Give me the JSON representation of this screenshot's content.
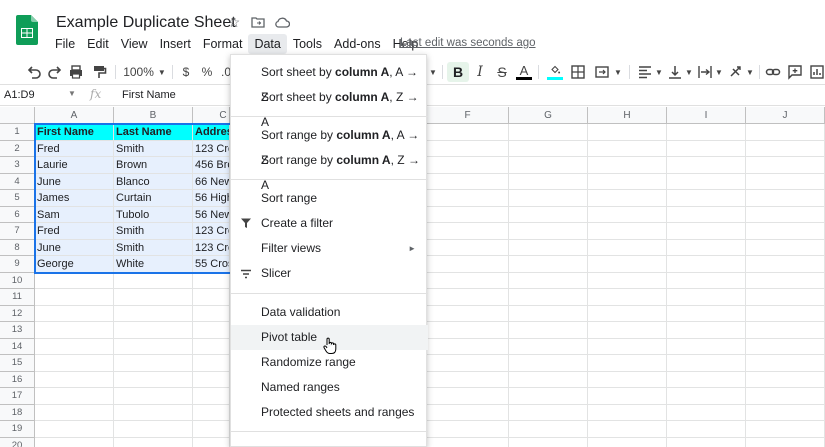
{
  "app": {
    "title": "Example Duplicate Sheet",
    "last_edit": "Last edit was seconds ago",
    "brand_color": "#0f9d58"
  },
  "menubar": [
    "File",
    "Edit",
    "View",
    "Insert",
    "Format",
    "Data",
    "Tools",
    "Add-ons",
    "Help"
  ],
  "toolbar": {
    "zoom": "100%",
    "currency": "$",
    "percent": "%",
    "decimal": ".0"
  },
  "formula_bar": {
    "name_box": "A1:D9",
    "fx": "fx",
    "content": "First Name"
  },
  "columns": [
    "A",
    "B",
    "C",
    "F",
    "G",
    "H",
    "I",
    "J"
  ],
  "rows": [
    "1",
    "2",
    "3",
    "4",
    "5",
    "6",
    "7",
    "8",
    "9",
    "10",
    "11",
    "12",
    "13",
    "14",
    "15",
    "16",
    "17",
    "18",
    "19",
    "20"
  ],
  "table": {
    "headers": [
      "First Name",
      "Last Name",
      "Addres"
    ],
    "rows": [
      [
        "Fred",
        "Smith",
        "123 Cre"
      ],
      [
        "Laurie",
        "Brown",
        "456 Bro"
      ],
      [
        "June",
        "Blanco",
        "66 New"
      ],
      [
        "James",
        "Curtain",
        "56 High"
      ],
      [
        "Sam",
        "Tubolo",
        "56 New"
      ],
      [
        "Fred",
        "Smith",
        "123 Cre"
      ],
      [
        "June",
        "Smith",
        "123 Cre"
      ],
      [
        "George",
        "White",
        "55 Cros"
      ]
    ],
    "header_color": "#00ffff"
  },
  "data_menu": {
    "sort_sheet_az": {
      "pre": "Sort sheet by ",
      "bold": "column A",
      "post": ", A → Z"
    },
    "sort_sheet_za": {
      "pre": "Sort sheet by ",
      "bold": "column A",
      "post": ", Z → A"
    },
    "sort_range_az": {
      "pre": "Sort range by ",
      "bold": "column A",
      "post": ", A → Z"
    },
    "sort_range_za": {
      "pre": "Sort range by ",
      "bold": "column A",
      "post": ", Z → A"
    },
    "sort_range": "Sort range",
    "create_filter": "Create a filter",
    "filter_views": "Filter views",
    "slicer": "Slicer",
    "data_validation": "Data validation",
    "pivot_table": "Pivot table",
    "randomize_range": "Randomize range",
    "named_ranges": "Named ranges",
    "protected": "Protected sheets and ranges",
    "submenu_arrow": "►"
  }
}
